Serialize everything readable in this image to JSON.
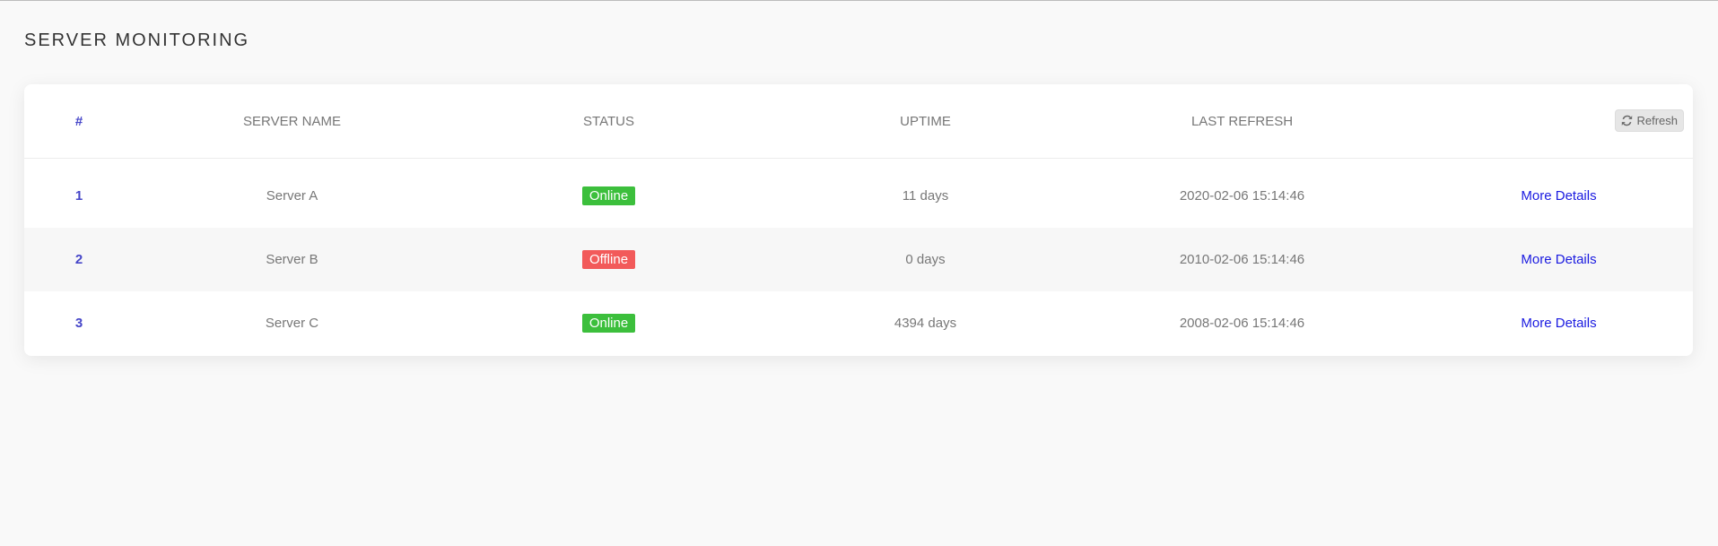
{
  "page": {
    "title": "SERVER MONITORING"
  },
  "table": {
    "columns": [
      "#",
      "SERVER NAME",
      "STATUS",
      "UPTIME",
      "LAST REFRESH"
    ],
    "refresh_label": "Refresh",
    "rows": [
      {
        "index": "1",
        "name": "Server A",
        "status": "Online",
        "uptime": "11 days",
        "last_refresh": "2020-02-06 15:14:46",
        "action": "More Details"
      },
      {
        "index": "2",
        "name": "Server B",
        "status": "Offline",
        "uptime": "0 days",
        "last_refresh": "2010-02-06 15:14:46",
        "action": "More Details"
      },
      {
        "index": "3",
        "name": "Server C",
        "status": "Online",
        "uptime": "4394 days",
        "last_refresh": "2008-02-06 15:14:46",
        "action": "More Details"
      }
    ]
  },
  "colors": {
    "online": "#3cbf3c",
    "offline": "#f25a5a",
    "link": "#1a1ae0",
    "index": "#4545c8"
  }
}
